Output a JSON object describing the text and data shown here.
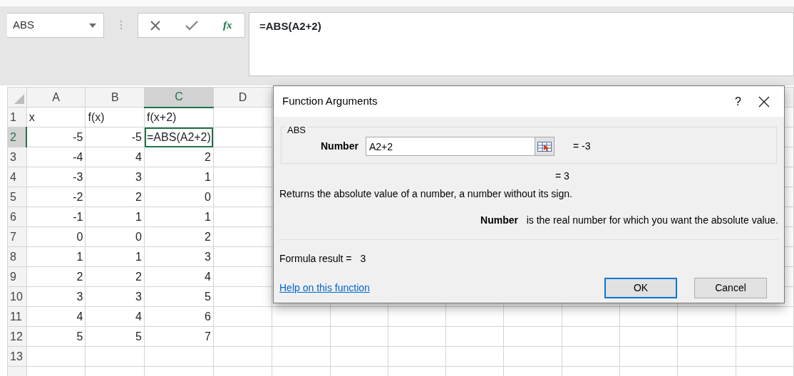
{
  "name_box": {
    "value": "ABS"
  },
  "formula_buttons": {
    "insert_function": "fx"
  },
  "formula_bar": {
    "value": "=ABS(A2+2)"
  },
  "sheet": {
    "columns": [
      {
        "label": "A",
        "selected": false
      },
      {
        "label": "B",
        "selected": false
      },
      {
        "label": "C",
        "selected": true
      },
      {
        "label": "D",
        "selected": false
      }
    ],
    "rows": [
      {
        "label": "1",
        "selected": false,
        "cells": [
          {
            "text": "x",
            "kind": "text"
          },
          {
            "text": "f(x)",
            "kind": "text"
          },
          {
            "text": "f(x+2)",
            "kind": "text"
          }
        ]
      },
      {
        "label": "2",
        "selected": true,
        "cells": [
          {
            "text": "-5",
            "kind": "number"
          },
          {
            "text": "-5",
            "kind": "number"
          },
          {
            "text": "=ABS(A2+2)",
            "kind": "editing"
          }
        ]
      },
      {
        "label": "3",
        "selected": false,
        "cells": [
          {
            "text": "-4",
            "kind": "number"
          },
          {
            "text": "4",
            "kind": "number"
          },
          {
            "text": "2",
            "kind": "number"
          }
        ]
      },
      {
        "label": "4",
        "selected": false,
        "cells": [
          {
            "text": "-3",
            "kind": "number"
          },
          {
            "text": "3",
            "kind": "number"
          },
          {
            "text": "1",
            "kind": "number"
          }
        ]
      },
      {
        "label": "5",
        "selected": false,
        "cells": [
          {
            "text": "-2",
            "kind": "number"
          },
          {
            "text": "2",
            "kind": "number"
          },
          {
            "text": "0",
            "kind": "number"
          }
        ]
      },
      {
        "label": "6",
        "selected": false,
        "cells": [
          {
            "text": "-1",
            "kind": "number"
          },
          {
            "text": "1",
            "kind": "number"
          },
          {
            "text": "1",
            "kind": "number"
          }
        ]
      },
      {
        "label": "7",
        "selected": false,
        "cells": [
          {
            "text": "0",
            "kind": "number"
          },
          {
            "text": "0",
            "kind": "number"
          },
          {
            "text": "2",
            "kind": "number"
          }
        ]
      },
      {
        "label": "8",
        "selected": false,
        "cells": [
          {
            "text": "1",
            "kind": "number"
          },
          {
            "text": "1",
            "kind": "number"
          },
          {
            "text": "3",
            "kind": "number"
          }
        ]
      },
      {
        "label": "9",
        "selected": false,
        "cells": [
          {
            "text": "2",
            "kind": "number"
          },
          {
            "text": "2",
            "kind": "number"
          },
          {
            "text": "4",
            "kind": "number"
          }
        ]
      },
      {
        "label": "10",
        "selected": false,
        "cells": [
          {
            "text": "3",
            "kind": "number"
          },
          {
            "text": "3",
            "kind": "number"
          },
          {
            "text": "5",
            "kind": "number"
          }
        ]
      },
      {
        "label": "11",
        "selected": false,
        "cells": [
          {
            "text": "4",
            "kind": "number"
          },
          {
            "text": "4",
            "kind": "number"
          },
          {
            "text": "6",
            "kind": "number"
          }
        ]
      },
      {
        "label": "12",
        "selected": false,
        "cells": [
          {
            "text": "5",
            "kind": "number"
          },
          {
            "text": "5",
            "kind": "number"
          },
          {
            "text": "7",
            "kind": "number"
          }
        ]
      },
      {
        "label": "13",
        "selected": false,
        "cells": []
      }
    ]
  },
  "dialog": {
    "title": "Function Arguments",
    "help": "?",
    "function_name": "ABS",
    "argument": {
      "label": "Number",
      "value": "A2+2",
      "result": "= -3"
    },
    "function_result": "= 3",
    "description": "Returns the absolute value of a number, a number without its sign.",
    "argument_help": "**Number**   is the real number for which you want the absolute value.",
    "formula_result_label": "Formula result =",
    "formula_result": "3",
    "help_link": "Help on this function",
    "buttons": [
      {
        "label": "OK",
        "selected": true
      },
      {
        "label": "Cancel",
        "selected": false
      }
    ]
  }
}
